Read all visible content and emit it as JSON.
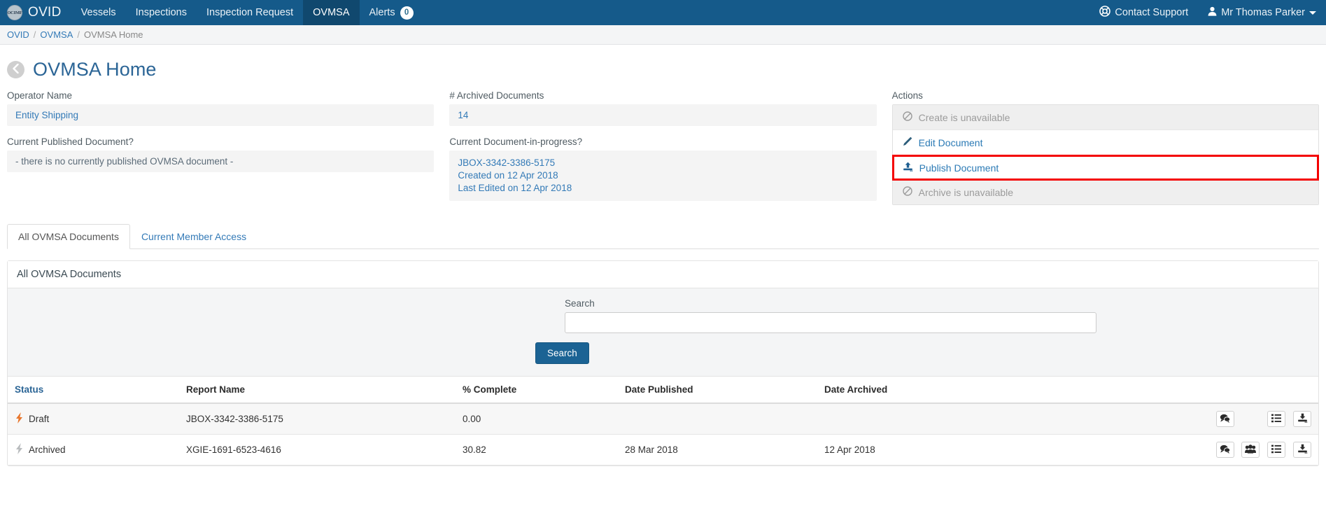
{
  "navbar": {
    "logo_text": "OCIMF",
    "brand": "OVID",
    "items": [
      {
        "label": "Vessels",
        "active": false
      },
      {
        "label": "Inspections",
        "active": false
      },
      {
        "label": "Inspection Request",
        "active": false
      },
      {
        "label": "OVMSA",
        "active": true
      },
      {
        "label": "Alerts",
        "active": false,
        "badge": "0"
      }
    ],
    "support_label": "Contact Support",
    "user_label": "Mr Thomas Parker",
    "bg_color": "#155a8a",
    "active_bg_color": "#10486e"
  },
  "breadcrumb": {
    "items": [
      "OVID",
      "OVMSA"
    ],
    "current": "OVMSA Home",
    "separator": "/"
  },
  "page": {
    "title": "OVMSA Home"
  },
  "info": {
    "operator_name_label": "Operator Name",
    "operator_name_value": "Entity Shipping",
    "archived_docs_label": "# Archived Documents",
    "archived_docs_value": "14",
    "published_doc_label": "Current Published Document?",
    "published_doc_value": "- there is no currently published OVMSA document -",
    "in_progress_label": "Current Document-in-progress?",
    "in_progress_name": "JBOX-3342-3386-5175",
    "in_progress_created": "Created on 12 Apr 2018",
    "in_progress_edited": "Last Edited on 12 Apr 2018"
  },
  "actions": {
    "label": "Actions",
    "items": [
      {
        "label": "Create is unavailable",
        "icon": "ban-icon",
        "state": "disabled",
        "highlighted": false
      },
      {
        "label": "Edit Document",
        "icon": "pencil-icon",
        "state": "enabled",
        "highlighted": false
      },
      {
        "label": "Publish Document",
        "icon": "upload-icon",
        "state": "enabled",
        "highlighted": true
      },
      {
        "label": "Archive is unavailable",
        "icon": "ban-icon",
        "state": "disabled",
        "highlighted": false
      }
    ],
    "highlight_color": "#f40000"
  },
  "tabs": [
    {
      "label": "All OVMSA Documents",
      "active": true
    },
    {
      "label": "Current Member Access",
      "active": false
    }
  ],
  "panel": {
    "heading": "All OVMSA Documents",
    "search_label": "Search",
    "search_value": "",
    "search_placeholder": "",
    "search_button": "Search"
  },
  "table": {
    "columns": [
      {
        "label": "Status",
        "sortable": true
      },
      {
        "label": "Report Name",
        "sortable": false
      },
      {
        "label": "% Complete",
        "sortable": false
      },
      {
        "label": "Date Published",
        "sortable": false
      },
      {
        "label": "Date Archived",
        "sortable": false
      }
    ],
    "rows": [
      {
        "status": "Draft",
        "status_icon": "bolt-icon",
        "status_color": "#e8762c",
        "report_name": "JBOX-3342-3386-5175",
        "percent_complete": "0.00",
        "date_published": "",
        "date_archived": "",
        "actions": [
          "comments-icon",
          "list-icon",
          "download-icon"
        ]
      },
      {
        "status": "Archived",
        "status_icon": "bolt-icon",
        "status_color": "#b9bcbe",
        "report_name": "XGIE-1691-6523-4616",
        "percent_complete": "30.82",
        "date_published": "28 Mar 2018",
        "date_archived": "12 Apr 2018",
        "actions": [
          "comments-icon",
          "users-icon",
          "list-icon",
          "download-icon"
        ]
      }
    ]
  }
}
